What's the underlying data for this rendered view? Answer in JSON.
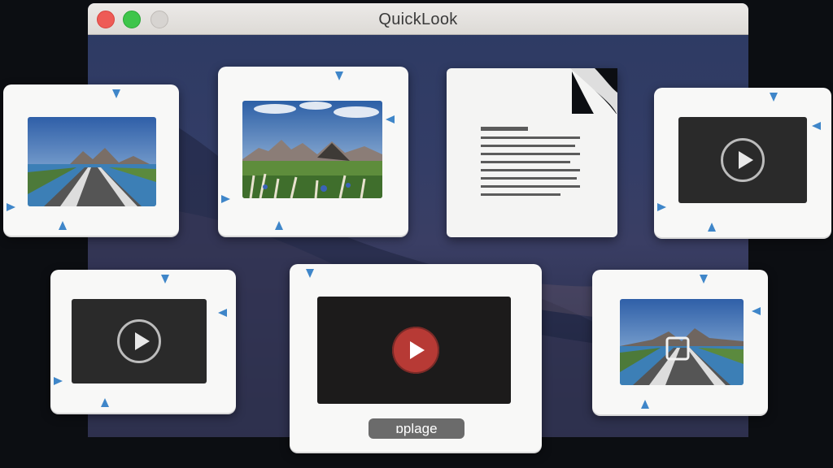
{
  "window": {
    "title": "QuickLook"
  },
  "controls": {
    "close": "close-button",
    "minimize": "minimize-button",
    "zoom": "zoom-button"
  },
  "thumbnails": [
    {
      "kind": "image",
      "subject": "road-landscape"
    },
    {
      "kind": "image",
      "subject": "mountain-meadow"
    },
    {
      "kind": "document"
    },
    {
      "kind": "video"
    },
    {
      "kind": "video"
    },
    {
      "kind": "video",
      "selected": true
    },
    {
      "kind": "image",
      "subject": "road-landscape"
    }
  ],
  "selected_item": {
    "label": "ɒplage"
  },
  "colors": {
    "accent_tick": "#3f86c9",
    "play_red": "#b73a35",
    "traffic_close": "#ee5b56",
    "traffic_min": "#3ec54b"
  }
}
